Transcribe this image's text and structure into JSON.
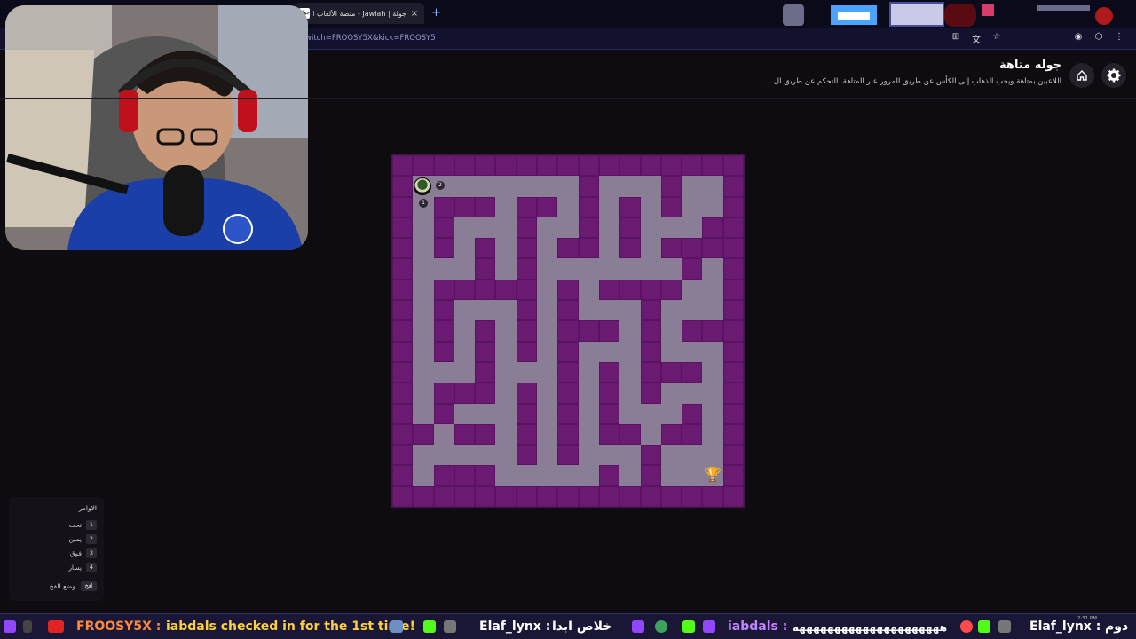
{
  "browser": {
    "tab_title": "جولة | Jawlah - منصة الألعاب ال...",
    "tab_favicon": "جولة",
    "new_tab_symbol": "+",
    "close_symbol": "×",
    "url": "witch=FROOSY5X&kick=FROOSY5"
  },
  "page": {
    "title": "جوله متاهة",
    "description": "اللاعبين بمتاهة ويجب الذهاب إلى الكأس عن طريق المرور عبر المتاهة. التحكم عن طريق ال..."
  },
  "maze": {
    "wall_color": "#6a1a70",
    "path_color": "#8a7e96",
    "player_badge_number": "2",
    "player_label_number": "1",
    "goal_icon": "trophy-icon"
  },
  "commands": {
    "title": "الاوامر",
    "items": [
      {
        "key": "1",
        "label": "تحت"
      },
      {
        "key": "2",
        "label": "يمين"
      },
      {
        "key": "3",
        "label": "فوق"
      },
      {
        "key": "4",
        "label": "يسار"
      }
    ],
    "footer_key": "افخ",
    "footer_label": "وضع الفخ"
  },
  "ticker": {
    "streamer": "FROOSY5X :",
    "message1": "iabdals checked in for the 1st time!",
    "user2": "Elaf_lynx :",
    "message2": "خلاص ابدا",
    "user3": "iabdals :",
    "message3": "هههههههههههههههههههههه",
    "user4": "Elaf_lynx :",
    "message4": "دوم",
    "clock": "2:31 PM"
  },
  "colors": {
    "accent": "#9146ff",
    "kick_green": "#53fc18",
    "ticker_red": "#ff4a4a"
  }
}
